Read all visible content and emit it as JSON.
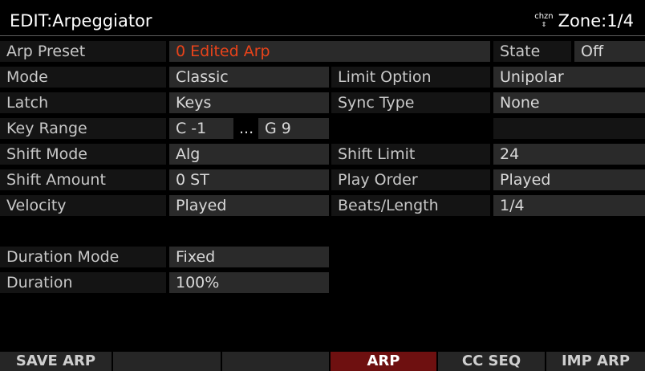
{
  "header": {
    "title": "EDIT:Arpeggiator",
    "channel_icon": "chzn",
    "zone": "Zone:1/4"
  },
  "rows": {
    "arp_preset": {
      "label": "Arp Preset",
      "value": "0 Edited Arp"
    },
    "state": {
      "label": "State",
      "value": "Off"
    },
    "mode": {
      "label": "Mode",
      "value": "Classic"
    },
    "limit_option": {
      "label": "Limit Option",
      "value": "Unipolar"
    },
    "latch": {
      "label": "Latch",
      "value": "Keys"
    },
    "sync_type": {
      "label": "Sync Type",
      "value": "None"
    },
    "key_range": {
      "label": "Key Range",
      "low": "C -1",
      "sep": "...",
      "high": "G 9"
    },
    "shift_mode": {
      "label": "Shift Mode",
      "value": "Alg"
    },
    "shift_limit": {
      "label": "Shift Limit",
      "value": "24"
    },
    "shift_amount": {
      "label": "Shift Amount",
      "value": "0 ST"
    },
    "play_order": {
      "label": "Play Order",
      "value": "Played"
    },
    "velocity": {
      "label": "Velocity",
      "value": "Played"
    },
    "beats_length": {
      "label": "Beats/Length",
      "value": "1/4"
    },
    "duration_mode": {
      "label": "Duration Mode",
      "value": "Fixed"
    },
    "duration": {
      "label": "Duration",
      "value": "100%"
    }
  },
  "softkeys": [
    {
      "label": "SAVE ARP",
      "active": false
    },
    {
      "label": "",
      "active": false
    },
    {
      "label": "",
      "active": false
    },
    {
      "label": "ARP",
      "active": true
    },
    {
      "label": "CC SEQ",
      "active": false
    },
    {
      "label": "IMP ARP",
      "active": false
    }
  ],
  "colors": {
    "background": "#000000",
    "selected_value": "#e8431a",
    "active_tab": "#6e1010"
  }
}
